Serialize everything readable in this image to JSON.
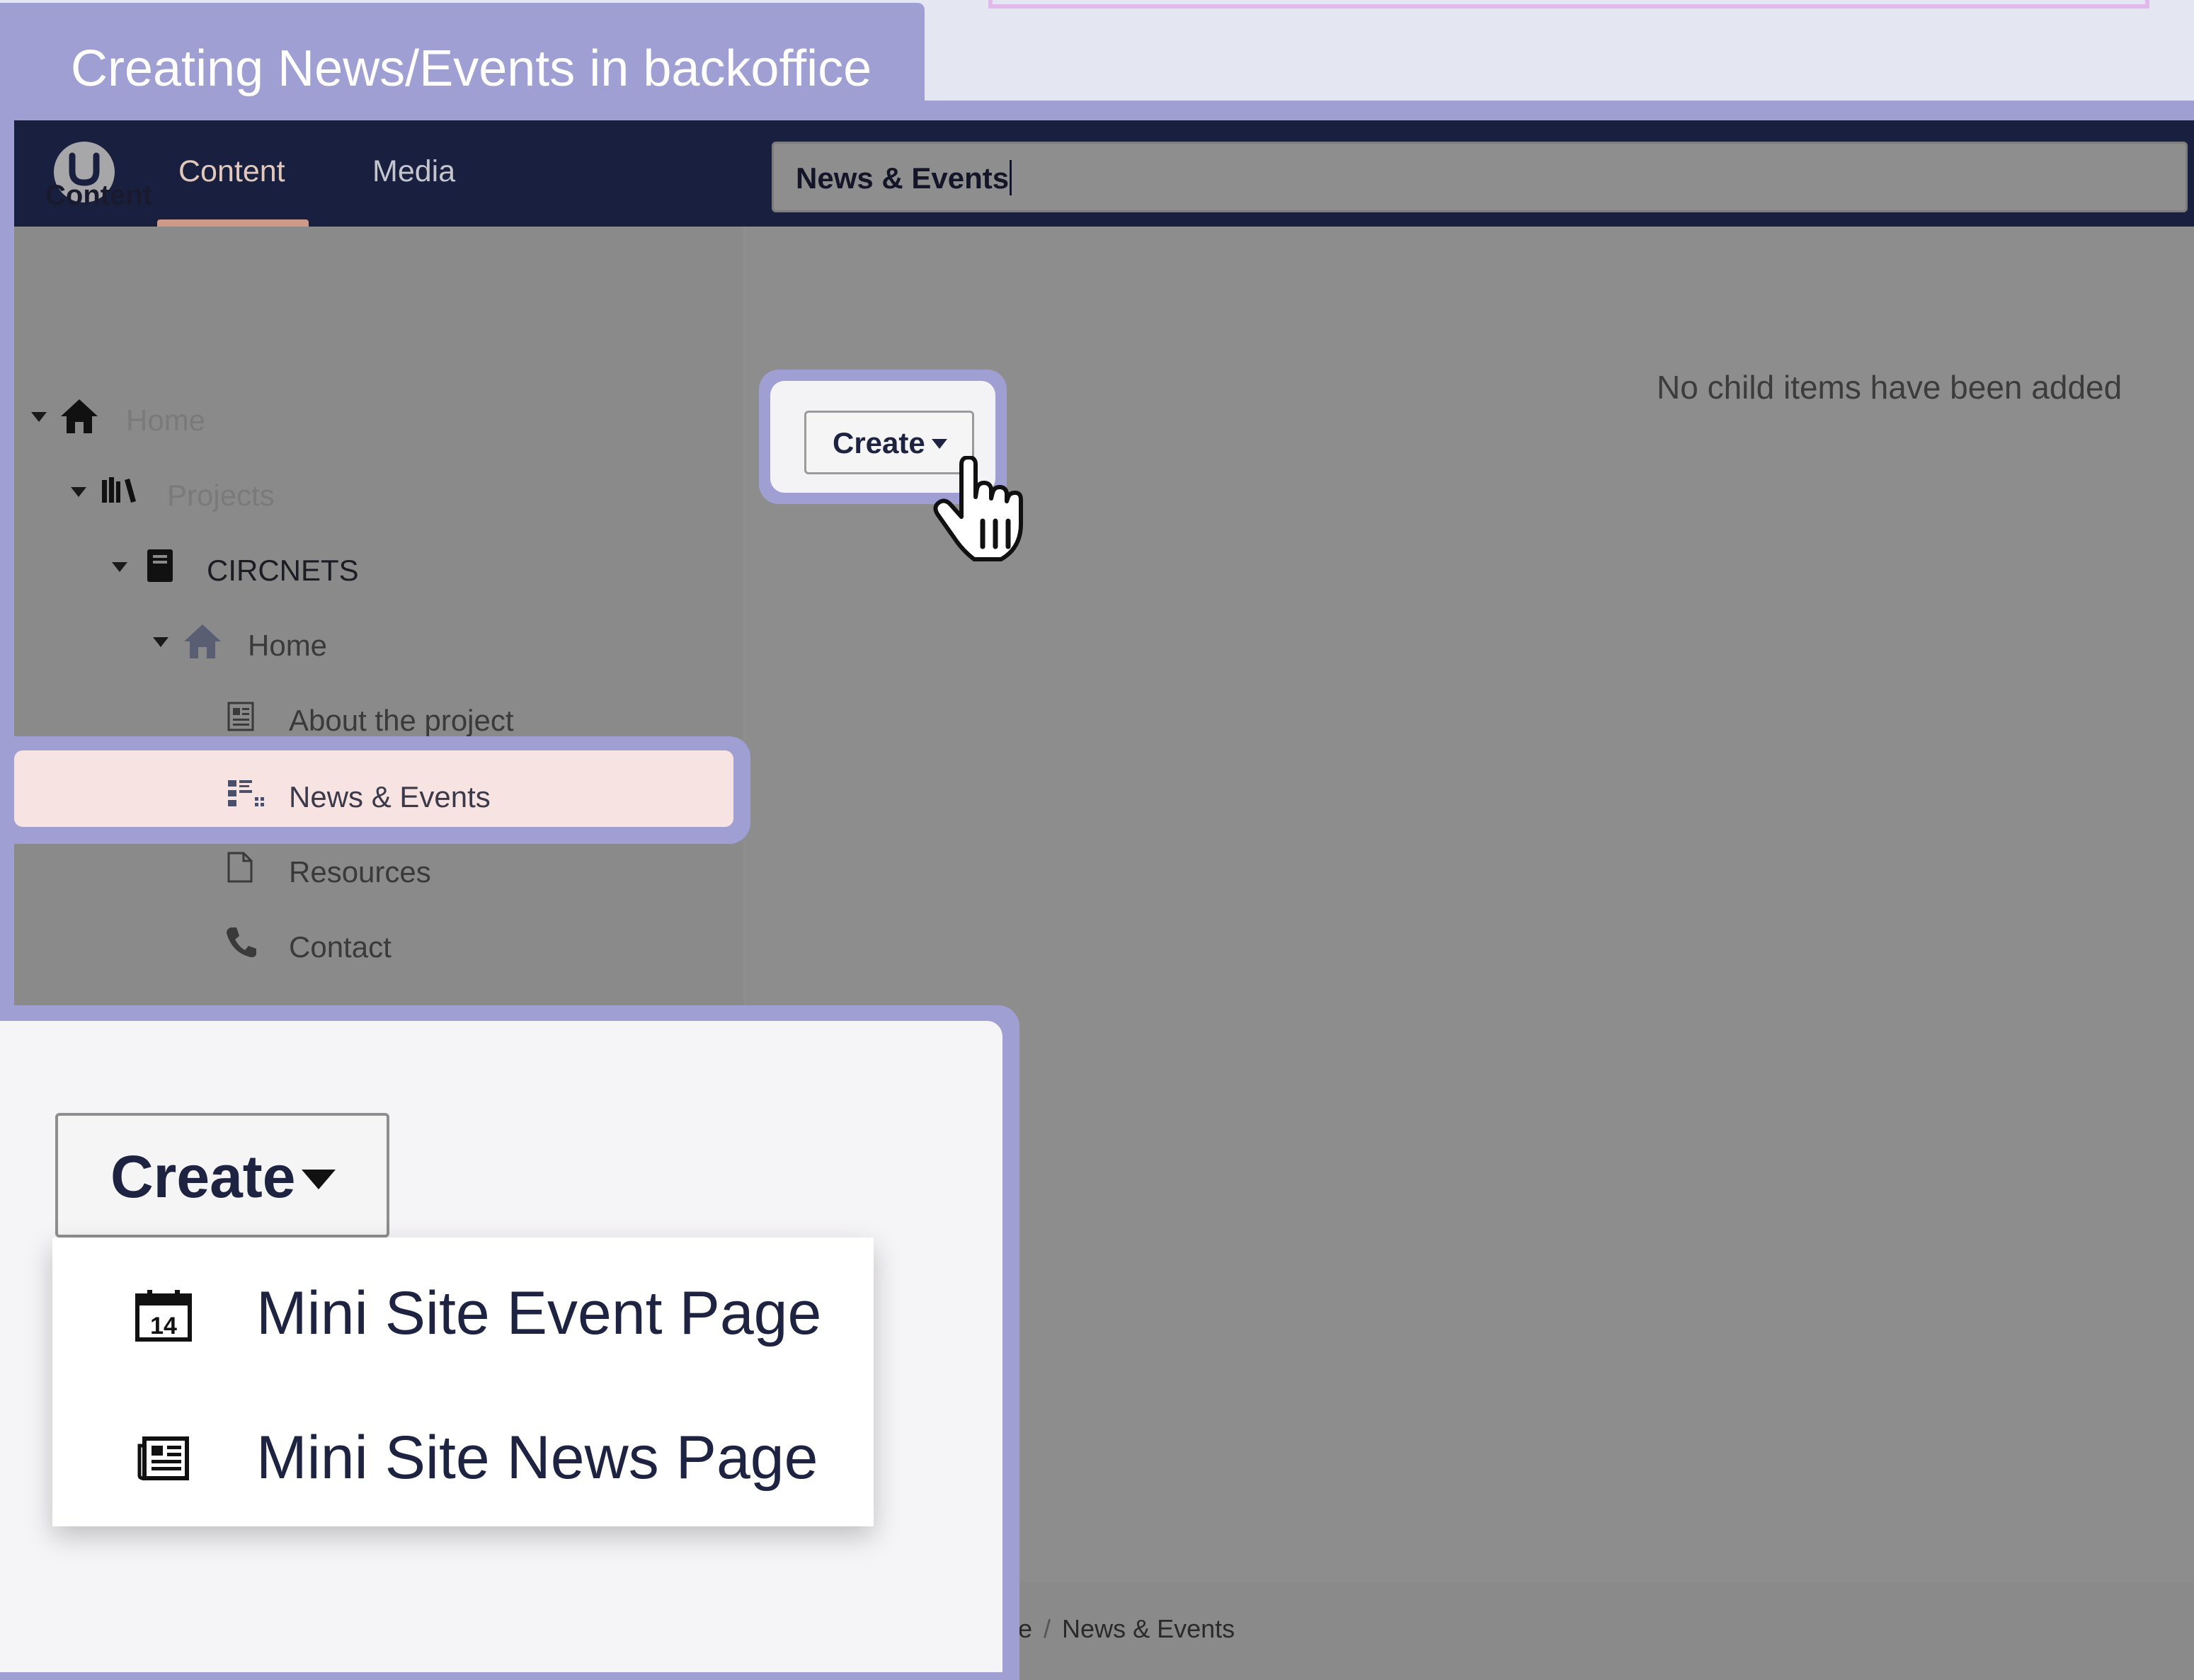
{
  "tutorial": {
    "title": "Creating News/Events in backoffice"
  },
  "topbar": {
    "tabs": [
      {
        "label": "Content"
      },
      {
        "label": "Media"
      }
    ]
  },
  "sidebar": {
    "title": "Content",
    "tree": [
      {
        "label": "Home",
        "icon": "home-icon"
      },
      {
        "label": "Projects",
        "icon": "library-icon"
      },
      {
        "label": "CIRCNETS",
        "icon": "book-icon"
      },
      {
        "label": "Home",
        "icon": "home-icon"
      },
      {
        "label": "About the project",
        "icon": "article-icon"
      },
      {
        "label": "News & Events",
        "icon": "news-grid-icon"
      },
      {
        "label": "Resources",
        "icon": "document-icon"
      },
      {
        "label": "Contact",
        "icon": "phone-icon"
      }
    ]
  },
  "main": {
    "name_value": "News & Events",
    "create_label": "Create",
    "empty_message": "No child items have been added"
  },
  "zoom": {
    "create_label": "Create",
    "menu": [
      {
        "label": "Mini Site Event Page",
        "icon": "calendar-icon",
        "icon_text": "14"
      },
      {
        "label": "Mini Site News Page",
        "icon": "newspaper-icon"
      }
    ]
  },
  "breadcrumb": {
    "partial": "e",
    "separator": "/",
    "current": "News & Events"
  },
  "colors": {
    "frame": "#a09fd4",
    "topbar": "#19203f",
    "selected_row": "#f7e3e1",
    "active_tab": "#e2c8ba"
  }
}
